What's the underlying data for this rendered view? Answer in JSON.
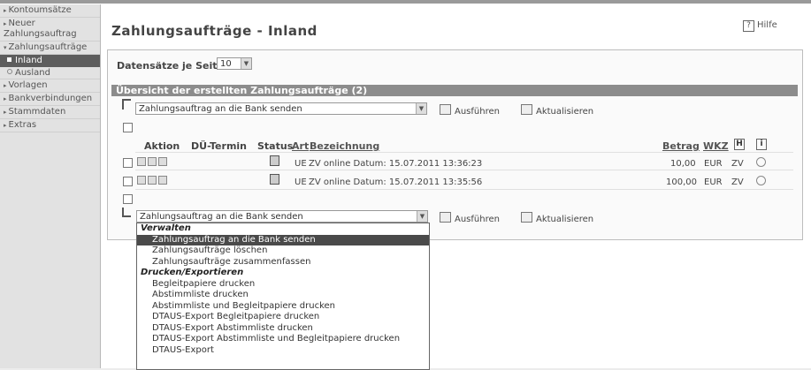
{
  "sidebar": {
    "items": [
      {
        "label": "Kontoumsätze"
      },
      {
        "label": "Neuer Zahlungsauftrag"
      },
      {
        "label": "Zahlungsaufträge"
      },
      {
        "label": "Inland"
      },
      {
        "label": "Ausland"
      },
      {
        "label": "Vorlagen"
      },
      {
        "label": "Bankverbindungen"
      },
      {
        "label": "Stammdaten"
      },
      {
        "label": "Extras"
      }
    ]
  },
  "page": {
    "title": "Zahlungsaufträge - Inland",
    "help": "Hilfe",
    "help_icon": "?"
  },
  "perpage": {
    "label": "Datensätze je Seite:",
    "value": "10"
  },
  "grid": {
    "heading": "Übersicht der erstellten Zahlungsaufträge (2)",
    "action_select_top": "Zahlungsauftrag an die Bank senden",
    "action_select_bottom": "Zahlungsauftrag an die Bank senden",
    "execute_label": "Ausführen",
    "refresh_label": "Aktualisieren",
    "columns": {
      "aktion": "Aktion",
      "termin": "DÜ-Termin",
      "status": "Status",
      "art": "Art",
      "bezeichnung": "Bezeichnung",
      "betrag": "Betrag",
      "wkz": "WKZ",
      "h": "H",
      "info": "i"
    },
    "rows": [
      {
        "art": "UE",
        "bezeichnung": "ZV online Datum: 15.07.2011 13:36:23",
        "betrag": "10,00",
        "wkz": "EUR",
        "h": "ZV"
      },
      {
        "art": "UE",
        "bezeichnung": "ZV online Datum: 15.07.2011 13:35:56",
        "betrag": "100,00",
        "wkz": "EUR",
        "h": "ZV"
      }
    ]
  },
  "dropdown": {
    "group1": "Verwalten",
    "group1_options": [
      "Zahlungsauftrag an die Bank senden",
      "Zahlungsaufträge löschen",
      "Zahlungsaufträge zusammenfassen"
    ],
    "group2": "Drucken/Exportieren",
    "group2_options": [
      "Begleitpapiere drucken",
      "Abstimmliste drucken",
      "Abstimmliste und Begleitpapiere drucken",
      "DTAUS-Export Begleitpapiere drucken",
      "DTAUS-Export Abstimmliste drucken",
      "DTAUS-Export Abstimmliste und Begleitpapiere drucken",
      "DTAUS-Export"
    ]
  },
  "colors": {
    "header_bg": "#8c8c8c",
    "active_nav": "#5d5d5d",
    "selected_option": "#4a4a4a"
  }
}
